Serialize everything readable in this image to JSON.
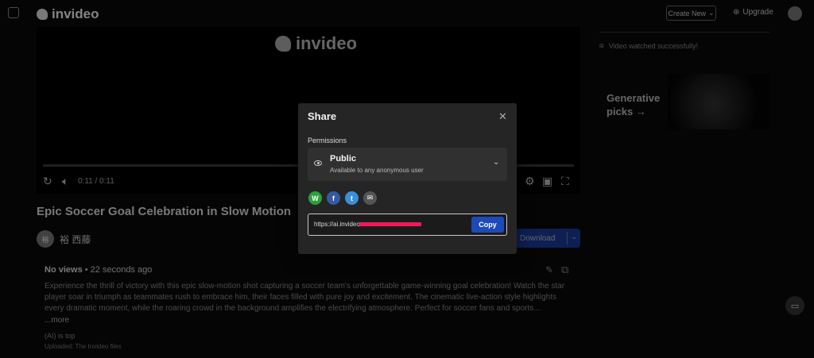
{
  "app": {
    "logo_text": "invideo",
    "upgrade_plan_label": "Create New",
    "upgrade_label": "Upgrade"
  },
  "video": {
    "watermark": "invideo",
    "time": "0:11 / 0:11",
    "title": "Epic Soccer Goal Celebration in Slow Motion",
    "channel_initials": "裕",
    "channel_name": "裕 西藤",
    "download_label": "Download"
  },
  "description": {
    "views": "No views",
    "age": "22 seconds ago",
    "text": "Experience the thrill of victory with this epic slow-motion shot capturing a soccer team's unforgettable game-winning goal celebration! Watch the star player soar in triumph as teammates rush to embrace him, their faces filled with pure joy and excitement. The cinematic live-action style highlights every dramatic moment, while the roaring crowd in the background amplifies the electrifying atmosphere. Perfect for soccer fans and sports...",
    "more": "...more",
    "tags": "(AI) is top",
    "credit": "Uploaded: The Invideo files"
  },
  "sidebar": {
    "notice": "Video watched successfully!",
    "generative_label": "Generative picks →"
  },
  "share_modal": {
    "title": "Share",
    "close_glyph": "✕",
    "permissions_label": "Permissions",
    "permission_title": "Public",
    "permission_subtitle": "Available to any anonymous user",
    "link_prefix": "https://ai.invideo",
    "copy_label": "Copy",
    "social": [
      "whatsapp-icon",
      "facebook-icon",
      "twitter-icon",
      "email-icon"
    ]
  },
  "colors": {
    "copy_button": "#1d4ab8",
    "redaction": "#f0195a",
    "modal_bg": "#252525"
  }
}
